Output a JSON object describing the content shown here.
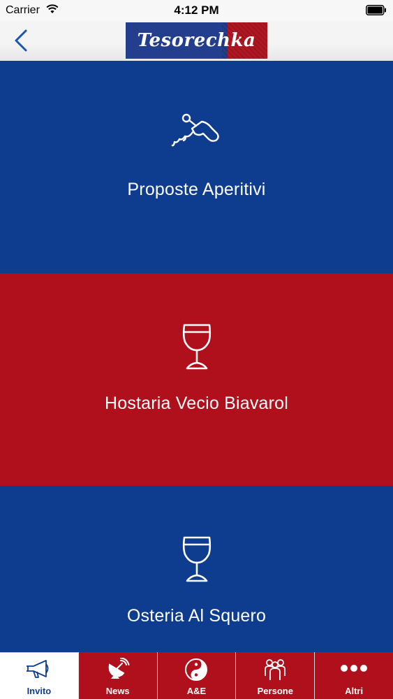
{
  "status_bar": {
    "carrier": "Carrier",
    "time": "4:12 PM",
    "icons": [
      "wifi-icon",
      "battery-icon"
    ]
  },
  "nav_bar": {
    "back_icon": "chevron-left-icon",
    "logo_text": "Tesorechka"
  },
  "tiles": [
    {
      "label": "Proposte Aperitivi",
      "icon": "corkscrew-icon",
      "color": "#0e3c8e"
    },
    {
      "label": "Hostaria Vecio Biavarol",
      "icon": "wine-glass-icon",
      "color": "#b00f1c"
    },
    {
      "label": "Osteria Al Squero",
      "icon": "wine-glass-icon",
      "color": "#0e3c8e"
    }
  ],
  "tab_bar": {
    "tabs": [
      {
        "label": "Invito",
        "icon": "megaphone-icon",
        "active": true
      },
      {
        "label": "News",
        "icon": "satellite-dish-icon",
        "active": false
      },
      {
        "label": "A&E",
        "icon": "yin-yang-icon",
        "active": false
      },
      {
        "label": "Persone",
        "icon": "people-icon",
        "active": false
      },
      {
        "label": "Altri",
        "icon": "more-dots-icon",
        "active": false
      }
    ]
  },
  "colors": {
    "brand_blue": "#0e3c8e",
    "brand_red": "#b00f1c",
    "nav_background": "#f4f4f4",
    "tint": "#1a56b0"
  }
}
